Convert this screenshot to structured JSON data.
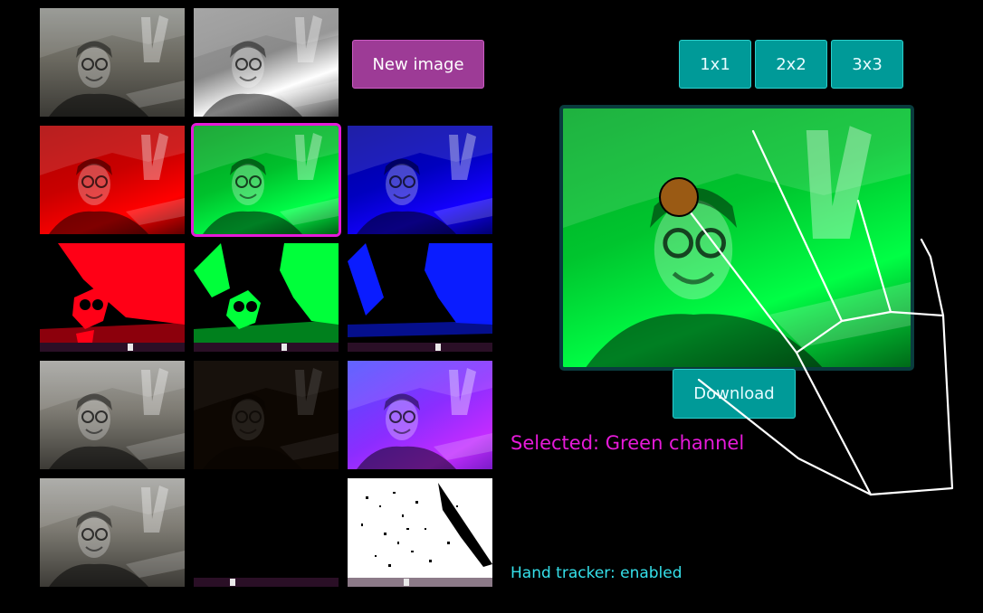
{
  "buttons": {
    "new_image": "New image",
    "grid_1x1": "1x1",
    "grid_2x2": "2x2",
    "grid_3x3": "3x3",
    "download": "Download"
  },
  "status": {
    "selected": "Selected: Green channel",
    "hand_tracker": "Hand tracker: enabled"
  },
  "colors": {
    "accent_magenta": "#e61ad9",
    "teal_button": "#009a98",
    "purple_button": "#9d3b96",
    "tracker_text": "#35e0ea"
  },
  "sliders": {
    "red_threshold": 0.63,
    "green_threshold": 0.63,
    "blue_threshold": 0.63,
    "black_tile": 0.26,
    "white_tile": 0.4
  }
}
